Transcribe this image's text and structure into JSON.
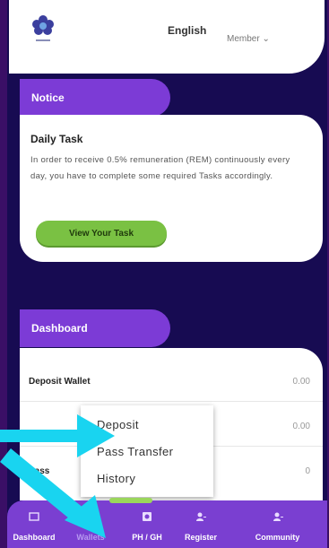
{
  "header": {
    "language": "English",
    "member_label": "Member ⌄"
  },
  "notice": {
    "tab_label": "Notice",
    "title": "Daily Task",
    "text": "In order to receive 0.5% remuneration (REM) continuously every day, you have to complete some required Tasks accordingly.",
    "button_label": "View Your Task"
  },
  "dashboard": {
    "tab_label": "Dashboard",
    "rows": [
      {
        "label": "Deposit Wallet",
        "value": "0.00"
      },
      {
        "label": "",
        "value": "0.00"
      },
      {
        "label": "Pass",
        "value": "0"
      }
    ]
  },
  "wallet_menu": {
    "items": [
      "Deposit",
      "Pass Transfer",
      "History"
    ]
  },
  "bottom_nav": {
    "items": [
      "Dashboard",
      "Wallets",
      "PH / GH",
      "Register",
      "Community"
    ]
  },
  "colors": {
    "background": "#170b52",
    "purple": "#7c3bd6",
    "green": "#7ac143",
    "arrow": "#19d4f0"
  }
}
